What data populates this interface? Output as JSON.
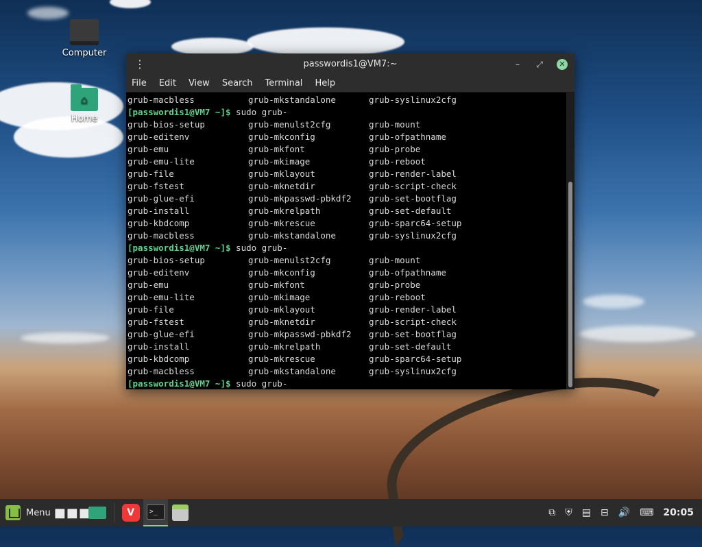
{
  "desktop": {
    "icons": [
      {
        "label": "Computer"
      },
      {
        "label": "Home"
      }
    ]
  },
  "window": {
    "title": "passwordis1@VM7:~",
    "menu": [
      "File",
      "Edit",
      "View",
      "Search",
      "Terminal",
      "Help"
    ]
  },
  "terminal": {
    "prompt": "[passwordis1@VM7 ~]$",
    "command": " sudo grub-",
    "first_row": [
      "grub-macbless",
      "grub-mkstandalone",
      "grub-syslinux2cfg"
    ],
    "completions": [
      [
        "grub-bios-setup",
        "grub-menulst2cfg",
        "grub-mount"
      ],
      [
        "grub-editenv",
        "grub-mkconfig",
        "grub-ofpathname"
      ],
      [
        "grub-emu",
        "grub-mkfont",
        "grub-probe"
      ],
      [
        "grub-emu-lite",
        "grub-mkimage",
        "grub-reboot"
      ],
      [
        "grub-file",
        "grub-mklayout",
        "grub-render-label"
      ],
      [
        "grub-fstest",
        "grub-mknetdir",
        "grub-script-check"
      ],
      [
        "grub-glue-efi",
        "grub-mkpasswd-pbkdf2",
        "grub-set-bootflag"
      ],
      [
        "grub-install",
        "grub-mkrelpath",
        "grub-set-default"
      ],
      [
        "grub-kbdcomp",
        "grub-mkrescue",
        "grub-sparc64-setup"
      ],
      [
        "grub-macbless",
        "grub-mkstandalone",
        "grub-syslinux2cfg"
      ]
    ]
  },
  "taskbar": {
    "menu_label": "Menu",
    "vivaldi_glyph": "V",
    "terminal_glyph": ">_",
    "clock": "20:05"
  },
  "colors": {
    "prompt": "#5fd38d",
    "accent": "#9ccc65",
    "folder": "#2fa37a"
  }
}
